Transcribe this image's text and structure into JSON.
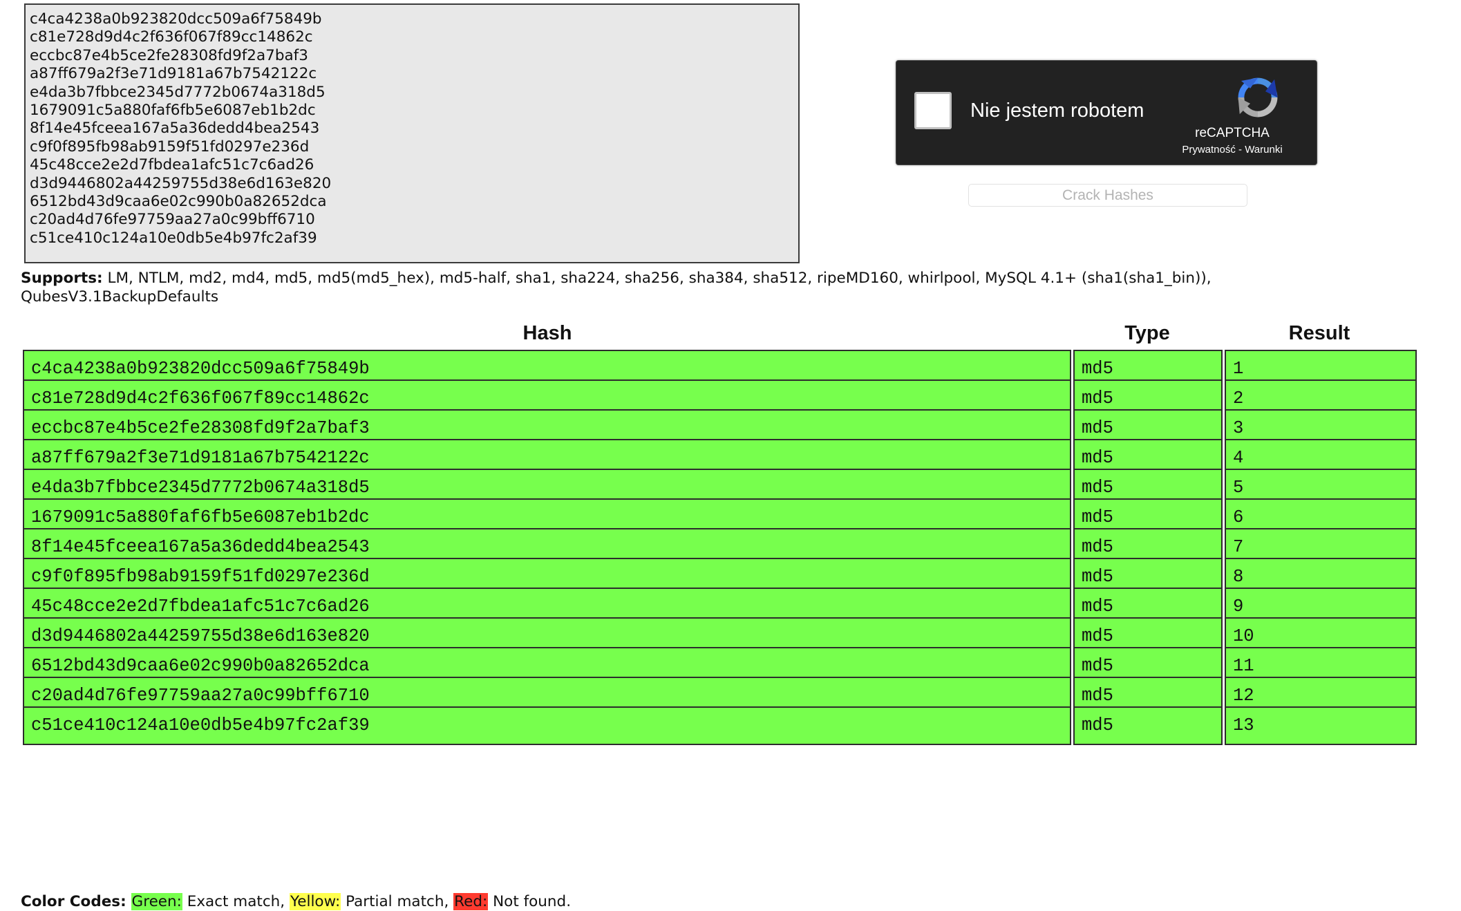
{
  "input": {
    "hashes": [
      "c4ca4238a0b923820dcc509a6f75849b",
      "c81e728d9d4c2f636f067f89cc14862c",
      "eccbc87e4b5ce2fe28308fd9f2a7baf3",
      "a87ff679a2f3e71d9181a67b7542122c",
      "e4da3b7fbbce2345d7772b0674a318d5",
      "1679091c5a880faf6fb5e6087eb1b2dc",
      "8f14e45fceea167a5a36dedd4bea2543",
      "c9f0f895fb98ab9159f51fd0297e236d",
      "45c48cce2e2d7fbdea1afc51c7c6ad26",
      "d3d9446802a44259755d38e6d163e820",
      "6512bd43d9caa6e02c990b0a82652dca",
      "c20ad4d76fe97759aa27a0c99bff6710",
      "c51ce410c124a10e0db5e4b97fc2af39"
    ]
  },
  "recaptcha": {
    "label": "Nie jestem robotem",
    "brand": "reCAPTCHA",
    "terms": "Prywatność - Warunki"
  },
  "crack_button": {
    "label": "Crack Hashes"
  },
  "supports": {
    "heading": "Supports:",
    "list": " LM, NTLM, md2, md4, md5, md5(md5_hex), md5-half, sha1, sha224, sha256, sha384, sha512, ripeMD160, whirlpool, MySQL 4.1+ (sha1(sha1_bin)), QubesV3.1BackupDefaults"
  },
  "results": {
    "headers": {
      "hash": "Hash",
      "type": "Type",
      "result": "Result"
    },
    "rows": [
      {
        "hash": "c4ca4238a0b923820dcc509a6f75849b",
        "type": "md5",
        "result": "1"
      },
      {
        "hash": "c81e728d9d4c2f636f067f89cc14862c",
        "type": "md5",
        "result": "2"
      },
      {
        "hash": "eccbc87e4b5ce2fe28308fd9f2a7baf3",
        "type": "md5",
        "result": "3"
      },
      {
        "hash": "a87ff679a2f3e71d9181a67b7542122c",
        "type": "md5",
        "result": "4"
      },
      {
        "hash": "e4da3b7fbbce2345d7772b0674a318d5",
        "type": "md5",
        "result": "5"
      },
      {
        "hash": "1679091c5a880faf6fb5e6087eb1b2dc",
        "type": "md5",
        "result": "6"
      },
      {
        "hash": "8f14e45fceea167a5a36dedd4bea2543",
        "type": "md5",
        "result": "7"
      },
      {
        "hash": "c9f0f895fb98ab9159f51fd0297e236d",
        "type": "md5",
        "result": "8"
      },
      {
        "hash": "45c48cce2e2d7fbdea1afc51c7c6ad26",
        "type": "md5",
        "result": "9"
      },
      {
        "hash": "d3d9446802a44259755d38e6d163e820",
        "type": "md5",
        "result": "10"
      },
      {
        "hash": "6512bd43d9caa6e02c990b0a82652dca",
        "type": "md5",
        "result": "11"
      },
      {
        "hash": "c20ad4d76fe97759aa27a0c99bff6710",
        "type": "md5",
        "result": "12"
      },
      {
        "hash": "c51ce410c124a10e0db5e4b97fc2af39",
        "type": "md5",
        "result": "13"
      }
    ],
    "row_color": "#77ff4d"
  },
  "color_codes": {
    "heading": "Color Codes:",
    "green_label": "Green:",
    "green_text": " Exact match, ",
    "yellow_label": "Yellow:",
    "yellow_text": " Partial match, ",
    "red_label": "Red:",
    "red_text": " Not found.",
    "green_color": "#77ff4d",
    "yellow_color": "#ffff4d",
    "red_color": "#ff3b30"
  }
}
